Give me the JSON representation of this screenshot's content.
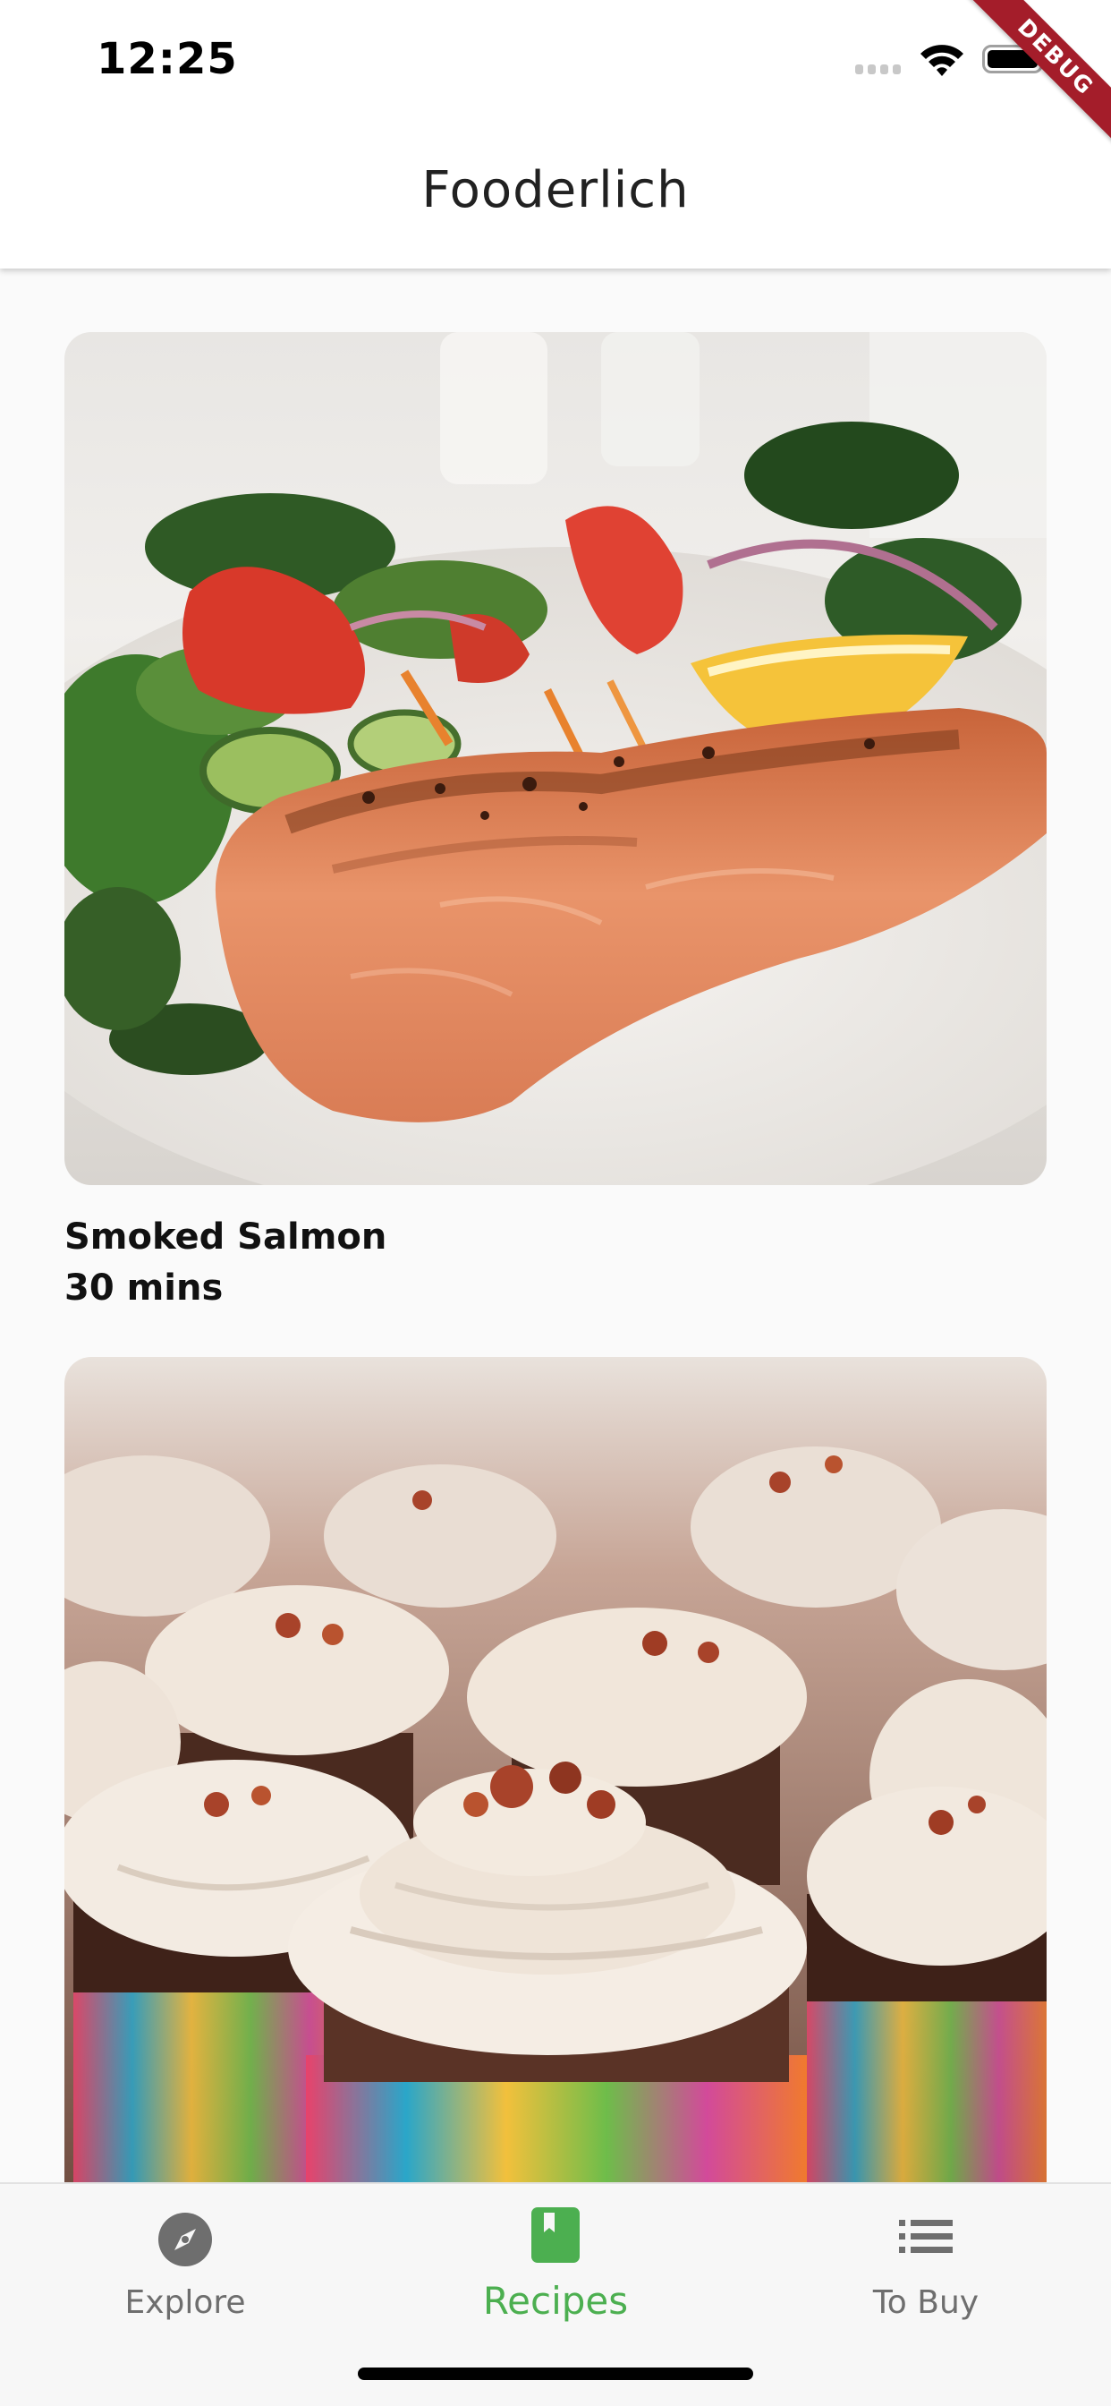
{
  "status_bar": {
    "time": "12:25",
    "signal_icon": "signal-bars-icon",
    "wifi_icon": "wifi-icon",
    "battery_icon": "battery-icon",
    "battery_level": 1.0
  },
  "debug_banner": "DEBUG",
  "app_bar": {
    "title": "Fooderlich"
  },
  "recipes": [
    {
      "name": "Smoked Salmon",
      "duration": "30 mins",
      "image_icon": "salmon-dish-image"
    },
    {
      "name": "",
      "duration": "",
      "image_icon": "cupcakes-image"
    }
  ],
  "bottom_nav": {
    "selected_index": 1,
    "items": [
      {
        "label": "Explore",
        "icon": "compass-icon"
      },
      {
        "label": "Recipes",
        "icon": "book-icon"
      },
      {
        "label": "To Buy",
        "icon": "list-icon"
      }
    ]
  },
  "colors": {
    "accent_active": "#4caf50",
    "nav_inactive": "#6e6e6e",
    "debug_banner": "#a41d2a",
    "app_bar_bg": "#ffffff",
    "page_bg": "#fafafa"
  }
}
